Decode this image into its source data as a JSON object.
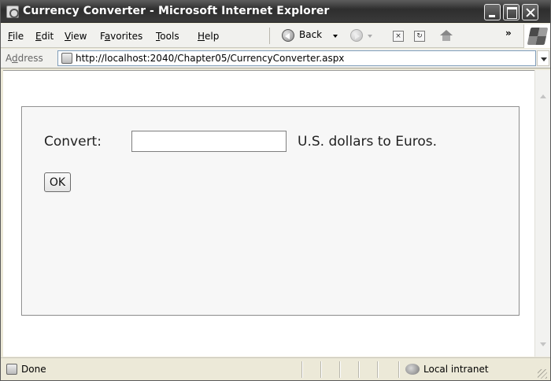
{
  "window": {
    "title": "Currency Converter - Microsoft Internet Explorer"
  },
  "menu": {
    "items": [
      {
        "first": "F",
        "rest": "ile"
      },
      {
        "first": "E",
        "rest": "dit"
      },
      {
        "first": "V",
        "rest": "iew"
      },
      {
        "pre": "F",
        "first": "a",
        "rest": "vorites"
      },
      {
        "first": "T",
        "rest": "ools"
      },
      {
        "first": "H",
        "rest": "elp"
      }
    ]
  },
  "toolbar": {
    "back_label": "Back",
    "overflow": "»"
  },
  "address": {
    "label_first": "d",
    "label_pre": "A",
    "label_rest": "dress",
    "url": "http://localhost:2040/Chapter05/CurrencyConverter.aspx"
  },
  "form": {
    "convert_label": "Convert:",
    "amount_value": "",
    "suffix_label": "U.S. dollars to Euros.",
    "ok_label": "OK"
  },
  "status": {
    "text": "Done",
    "zone": "Local intranet"
  }
}
